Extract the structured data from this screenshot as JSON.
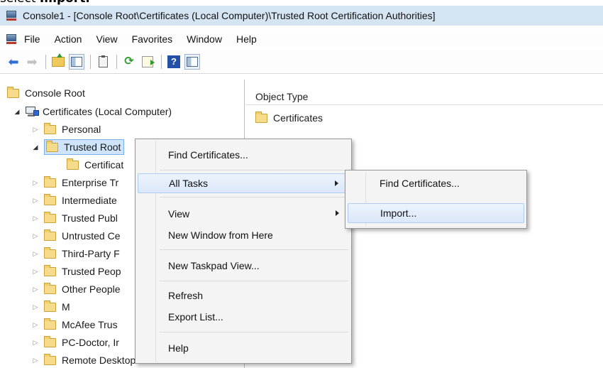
{
  "caption": {
    "prefix": "select ",
    "bold": "Import."
  },
  "window": {
    "title": "Console1 - [Console Root\\Certificates (Local Computer)\\Trusted Root Certification Authorities]"
  },
  "menu": [
    "File",
    "Action",
    "View",
    "Favorites",
    "Window",
    "Help"
  ],
  "toolbar": {
    "icons": [
      "back-arrow-icon",
      "forward-arrow-icon",
      "up-folder-icon",
      "show-hide-console-tree-icon",
      "properties-icon",
      "refresh-icon",
      "export-list-icon",
      "help-icon",
      "show-hide-action-pane-icon"
    ]
  },
  "tree": {
    "root": "Console Root",
    "computer": "Certificates (Local Computer)",
    "items": {
      "personal": "Personal",
      "trusted_root": "Trusted Root",
      "certificates_child": "Certificat",
      "enterprise": "Enterprise Tr",
      "intermediate": "Intermediate",
      "trusted_publishers": "Trusted Publ",
      "untrusted": "Untrusted Ce",
      "third_party": "Third-Party F",
      "trusted_people": "Trusted Peop",
      "other_people": "Other People",
      "m": "M",
      "mcafee": "McAfee Trus",
      "pc_doctor": "PC-Doctor, Ir",
      "remote_desktop": "Remote Desktop"
    }
  },
  "list": {
    "column_header": "Object Type",
    "rows": [
      "Certificates"
    ]
  },
  "context_menu": {
    "items": [
      "Find Certificates...",
      "All Tasks",
      "View",
      "New Window from Here",
      "New Taskpad View...",
      "Refresh",
      "Export List...",
      "Help"
    ],
    "highlighted": "All Tasks"
  },
  "submenu": {
    "items": [
      "Find Certificates...",
      "Import..."
    ],
    "highlighted": "Import..."
  }
}
